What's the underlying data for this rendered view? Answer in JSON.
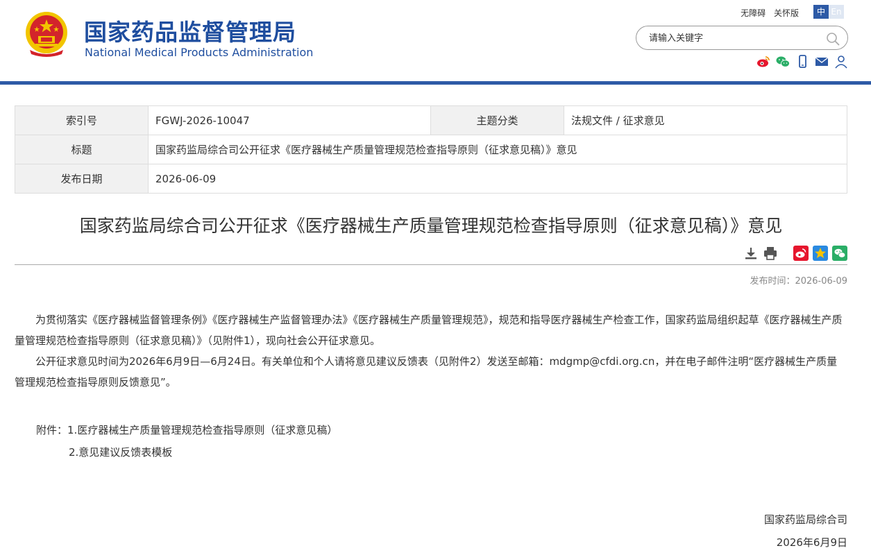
{
  "header": {
    "site_name_cn": "国家药品监督管理局",
    "site_name_en": "National Medical Products Administration",
    "links": {
      "accessibility": "无障碍",
      "care_mode": "关怀版"
    },
    "lang": {
      "zh": "中",
      "en": "En"
    },
    "search": {
      "placeholder": "请输入关键字"
    },
    "social_icons": [
      "weibo-icon",
      "wechat-icon",
      "mobile-icon",
      "mail-icon",
      "user-icon"
    ]
  },
  "info": {
    "index_label": "索引号",
    "index_value": "FGWJ-2026-10047",
    "topic_label": "主题分类",
    "topic_value": "法规文件 / 征求意见",
    "title_label": "标题",
    "title_value": "国家药监局综合司公开征求《医疗器械生产质量管理规范检查指导原则（征求意见稿）》意见",
    "date_label": "发布日期",
    "date_value": "2026-06-09"
  },
  "article": {
    "title": "国家药监局综合司公开征求《医疗器械生产质量管理规范检查指导原则（征求意见稿）》意见",
    "publish_time": "发布时间：2026-06-09",
    "paragraphs": [
      "为贯彻落实《医疗器械监督管理条例》《医疗器械生产监督管理办法》《医疗器械生产质量管理规范》，规范和指导医疗器械生产检查工作，国家药监局组织起草《医疗器械生产质量管理规范检查指导原则（征求意见稿）》（见附件1），现向社会公开征求意见。",
      "公开征求意见时间为2026年6月9日—6月24日。有关单位和个人请将意见建议反馈表（见附件2）发送至邮箱：mdgmp@cfdi.org.cn，并在电子邮件注明“医疗器械生产质量管理规范检查指导原则反馈意见”。"
    ],
    "attachments_label": "附件：",
    "attachments": [
      "1.医疗器械生产质量管理规范检查指导原则（征求意见稿）",
      "2.意见建议反馈表模板"
    ],
    "signature_org": "国家药监局综合司",
    "signature_date": "2026年6月9日"
  },
  "colors": {
    "brand_blue": "#1f4e9f",
    "bar_blue": "#2d5aa6",
    "emblem_red": "#d3242b",
    "emblem_gold": "#f2c500"
  }
}
